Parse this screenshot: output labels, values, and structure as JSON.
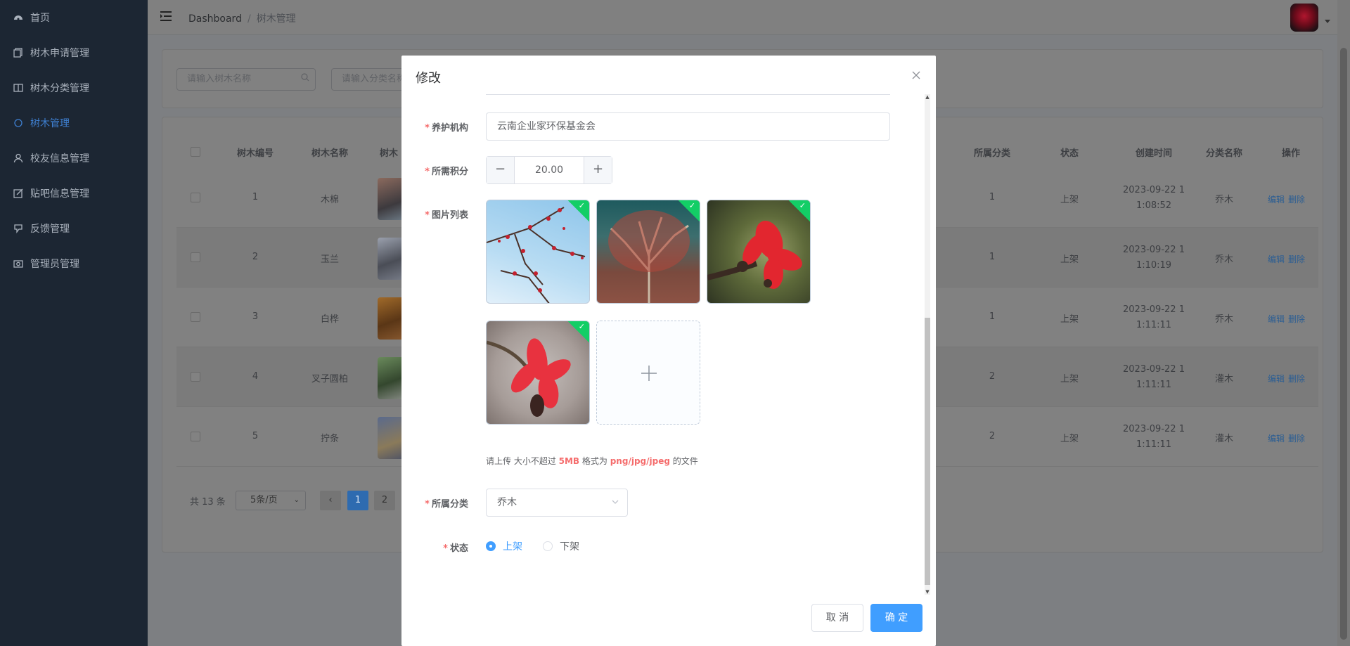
{
  "sidebar": {
    "items": [
      {
        "label": "首页",
        "icon": "dashboard-icon"
      },
      {
        "label": "树木申请管理",
        "icon": "documents-icon"
      },
      {
        "label": "树木分类管理",
        "icon": "book-icon"
      },
      {
        "label": "树木管理",
        "icon": "circle-icon",
        "active": true
      },
      {
        "label": "校友信息管理",
        "icon": "user-icon"
      },
      {
        "label": "贴吧信息管理",
        "icon": "edit-icon"
      },
      {
        "label": "反馈管理",
        "icon": "feedback-icon"
      },
      {
        "label": "管理员管理",
        "icon": "camera-icon"
      }
    ]
  },
  "navbar": {
    "breadcrumb": [
      "Dashboard",
      "/",
      "树木管理"
    ]
  },
  "search": {
    "name_placeholder": "请输入树木名称",
    "category_placeholder": "请输入分类名称"
  },
  "table": {
    "headers_left": [
      "树木编号",
      "树木名称",
      "树木"
    ],
    "headers_right": [
      "所属分类",
      "状态",
      "创建时间",
      "分类名称",
      "操作"
    ],
    "rows": [
      {
        "id": "1",
        "name": "木棉",
        "category": "1",
        "status": "上架",
        "created_1": "2023-09-22 1",
        "created_2": "1:08:52",
        "category_name": "乔木",
        "edit": "编辑",
        "delete": "删除",
        "thumb_color": "#6f5a50"
      },
      {
        "id": "2",
        "name": "玉兰",
        "category": "1",
        "status": "上架",
        "created_1": "2023-09-22 1",
        "created_2": "1:10:19",
        "category_name": "乔木",
        "edit": "编辑",
        "delete": "删除",
        "thumb_color": "#55585f"
      },
      {
        "id": "3",
        "name": "白桦",
        "category": "1",
        "status": "上架",
        "created_1": "2023-09-22 1",
        "created_2": "1:11:11",
        "category_name": "乔木",
        "edit": "编辑",
        "delete": "删除",
        "thumb_color": "#7a5326"
      },
      {
        "id": "4",
        "name": "叉子圆柏",
        "category": "2",
        "status": "上架",
        "created_1": "2023-09-22 1",
        "created_2": "1:11:11",
        "category_name": "灌木",
        "edit": "编辑",
        "delete": "删除",
        "thumb_color": "#4d6a45"
      },
      {
        "id": "5",
        "name": "拧条",
        "category": "2",
        "status": "上架",
        "created_1": "2023-09-22 1",
        "created_2": "1:11:11",
        "category_name": "灌木",
        "edit": "编辑",
        "delete": "删除",
        "thumb_color": "#536078"
      }
    ]
  },
  "pagination": {
    "total": "共 13 条",
    "page_size": "5条/页",
    "prev": "‹",
    "pages": [
      "1",
      "2"
    ]
  },
  "dialog": {
    "title": "修改",
    "fields": {
      "org_label": "养护机构",
      "org_value": "云南企业家环保基金会",
      "points_label": "所需积分",
      "points_value": "20.00",
      "minus": "−",
      "plus": "+",
      "images_label": "图片列表",
      "upload_tip_pre": "请上传 大小不超过 ",
      "upload_tip_size": "5MB",
      "upload_tip_mid": " 格式为 ",
      "upload_tip_fmt": "png/jpg/jpeg",
      "upload_tip_post": " 的文件",
      "category_label": "所属分类",
      "category_value": "乔木",
      "status_label": "状态",
      "status_on": "上架",
      "status_off": "下架"
    },
    "images": [
      {
        "desc": "kapok branches against sky"
      },
      {
        "desc": "kapok tree crown"
      },
      {
        "desc": "red kapok flower"
      },
      {
        "desc": "red kapok flower close-up"
      }
    ],
    "cancel_label": "取 消",
    "ok_label": "确 定"
  },
  "colors": {
    "primary": "#409eff",
    "sidebar_bg": "#1c2633",
    "required": "#f56c6c",
    "success_flag": "#13ce66"
  }
}
